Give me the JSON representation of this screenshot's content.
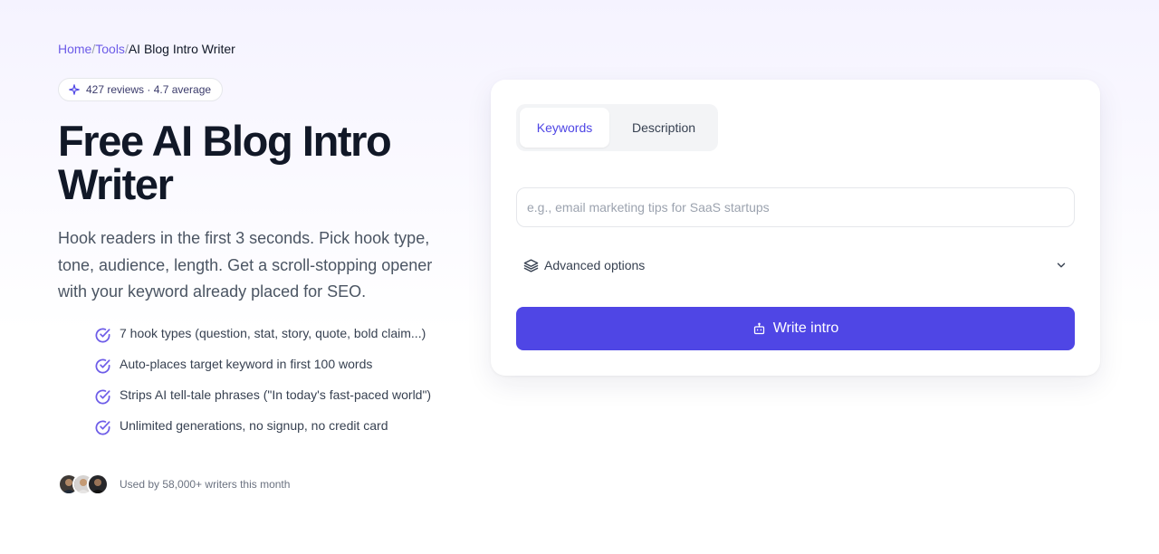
{
  "breadcrumb": {
    "home": "Home",
    "tools": "Tools",
    "current": "AI Blog Intro Writer",
    "separator": "/"
  },
  "rating": {
    "text": "427 reviews · 4.7 average",
    "icon": "sparkle-icon"
  },
  "hero": {
    "title": "Free AI Blog Intro Writer",
    "description": "Hook readers in the first 3 seconds. Pick hook type, tone, audience, length. Get a scroll-stopping opener with your keyword already placed for SEO."
  },
  "features": [
    "7 hook types (question, stat, story, quote, bold claim...)",
    "Auto-places target keyword in first 100 words",
    "Strips AI tell-tale phrases (\"In today's fast-paced world\")",
    "Unlimited generations, no signup, no credit card"
  ],
  "social_proof": {
    "text": "Used by 58,000+ writers this month"
  },
  "form": {
    "tabs": [
      {
        "label": "Keywords",
        "active": true
      },
      {
        "label": "Description",
        "active": false
      }
    ],
    "input": {
      "placeholder": "e.g., email marketing tips for SaaS startups",
      "value": ""
    },
    "advanced_label": "Advanced options",
    "submit_label": "Write intro"
  },
  "colors": {
    "accent": "#4f46e5",
    "link": "#6d5ce8",
    "check": "#6d5ce8"
  }
}
